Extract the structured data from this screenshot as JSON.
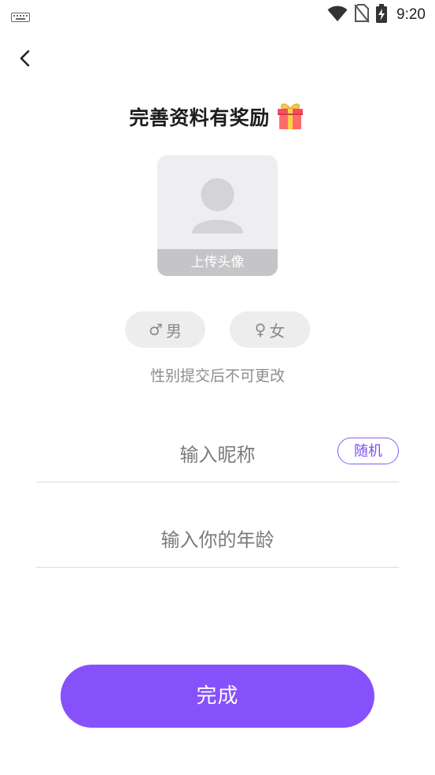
{
  "status_bar": {
    "time": "9:20",
    "icons": [
      "keyboard-icon",
      "wifi-icon",
      "no-sim-icon",
      "battery-charging-icon"
    ]
  },
  "header": {
    "back_icon": "chevron-left-icon",
    "title": "完善资料有奖励",
    "title_icon": "gift-icon"
  },
  "avatar": {
    "upload_label": "上传头像",
    "icon": "person-silhouette-icon"
  },
  "gender": {
    "male_symbol": "♂",
    "male_label": "男",
    "female_symbol": "♀",
    "female_label": "女",
    "note": "性别提交后不可更改"
  },
  "form": {
    "nickname_placeholder": "输入昵称",
    "nickname_value": "",
    "random_label": "随机",
    "age_placeholder": "输入你的年龄",
    "age_value": ""
  },
  "actions": {
    "done_label": "完成"
  },
  "colors": {
    "accent": "#8650fb",
    "accent_text": "#7b4fee",
    "chip_bg": "#ededed",
    "muted_text": "#8d8d8d"
  }
}
